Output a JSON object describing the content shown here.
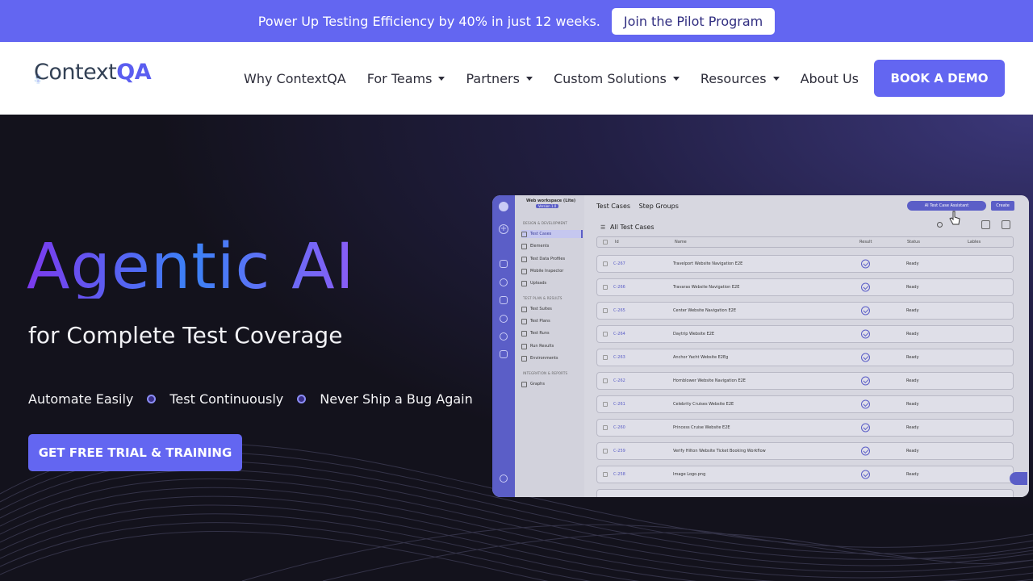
{
  "banner": {
    "text": "Power Up Testing Efficiency by 40% in just 12 weeks.",
    "button": "Join the Pilot Program"
  },
  "nav": {
    "logo_prefix": "Context",
    "logo_suffix": "QA",
    "items": [
      {
        "label": "Why ContextQA",
        "dropdown": false
      },
      {
        "label": "For Teams",
        "dropdown": true
      },
      {
        "label": "Partners",
        "dropdown": true
      },
      {
        "label": "Custom Solutions",
        "dropdown": true
      },
      {
        "label": "Resources",
        "dropdown": true
      },
      {
        "label": "About Us",
        "dropdown": false
      }
    ],
    "cta": "BOOK A DEMO"
  },
  "hero": {
    "headline": "Agentic AI",
    "subhead": "for Complete Test Coverage",
    "features": [
      "Automate Easily",
      "Test Continuously",
      "Never Ship a Bug Again"
    ],
    "cta": "GET FREE TRIAL & TRAINING"
  },
  "app": {
    "workspace": "Web workspace (Lite)",
    "version": "Version 1.0",
    "sections": [
      "DESIGN & DEVELOPMENT",
      "TEST PLAN & RESULTS",
      "INTEGRATION & REPORTS"
    ],
    "menu": {
      "design": [
        "Test Cases",
        "Elements",
        "Test Data Profiles",
        "Mobile Inspector",
        "Uploads"
      ],
      "plan": [
        "Test Suites",
        "Test Plans",
        "Test Runs",
        "Run Results",
        "Environments"
      ],
      "integration": [
        "Graphs"
      ]
    },
    "tabs": [
      "Test Cases",
      "Step Groups"
    ],
    "assistant_button": "AI Test Case Assistant",
    "create_button": "Create",
    "list_title": "All Test Cases",
    "columns": [
      "Id",
      "Name",
      "Result",
      "Status",
      "Lables"
    ],
    "rows": [
      {
        "id": "C-267",
        "name": "Travelport Website Navigation E2E",
        "status": "Ready"
      },
      {
        "id": "C-266",
        "name": "Travaras Website Navigation E2E",
        "status": "Ready"
      },
      {
        "id": "C-265",
        "name": "Center Website Navigation E2E",
        "status": "Ready"
      },
      {
        "id": "C-264",
        "name": "Daytrip Website E2E",
        "status": "Ready"
      },
      {
        "id": "C-263",
        "name": "Anchor Yacht Website E2Eg",
        "status": "Ready"
      },
      {
        "id": "C-262",
        "name": "Hornblower Website Navigation E2E",
        "status": "Ready"
      },
      {
        "id": "C-261",
        "name": "Celebrity Cruises Website E2E",
        "status": "Ready"
      },
      {
        "id": "C-260",
        "name": "Princess Cruise Website E2E",
        "status": "Ready"
      },
      {
        "id": "C-259",
        "name": "Verify Hilton Website Ticket Booking Workflow",
        "status": "Ready"
      },
      {
        "id": "C-258",
        "name": "Image Logo.png",
        "status": "Ready"
      }
    ]
  }
}
